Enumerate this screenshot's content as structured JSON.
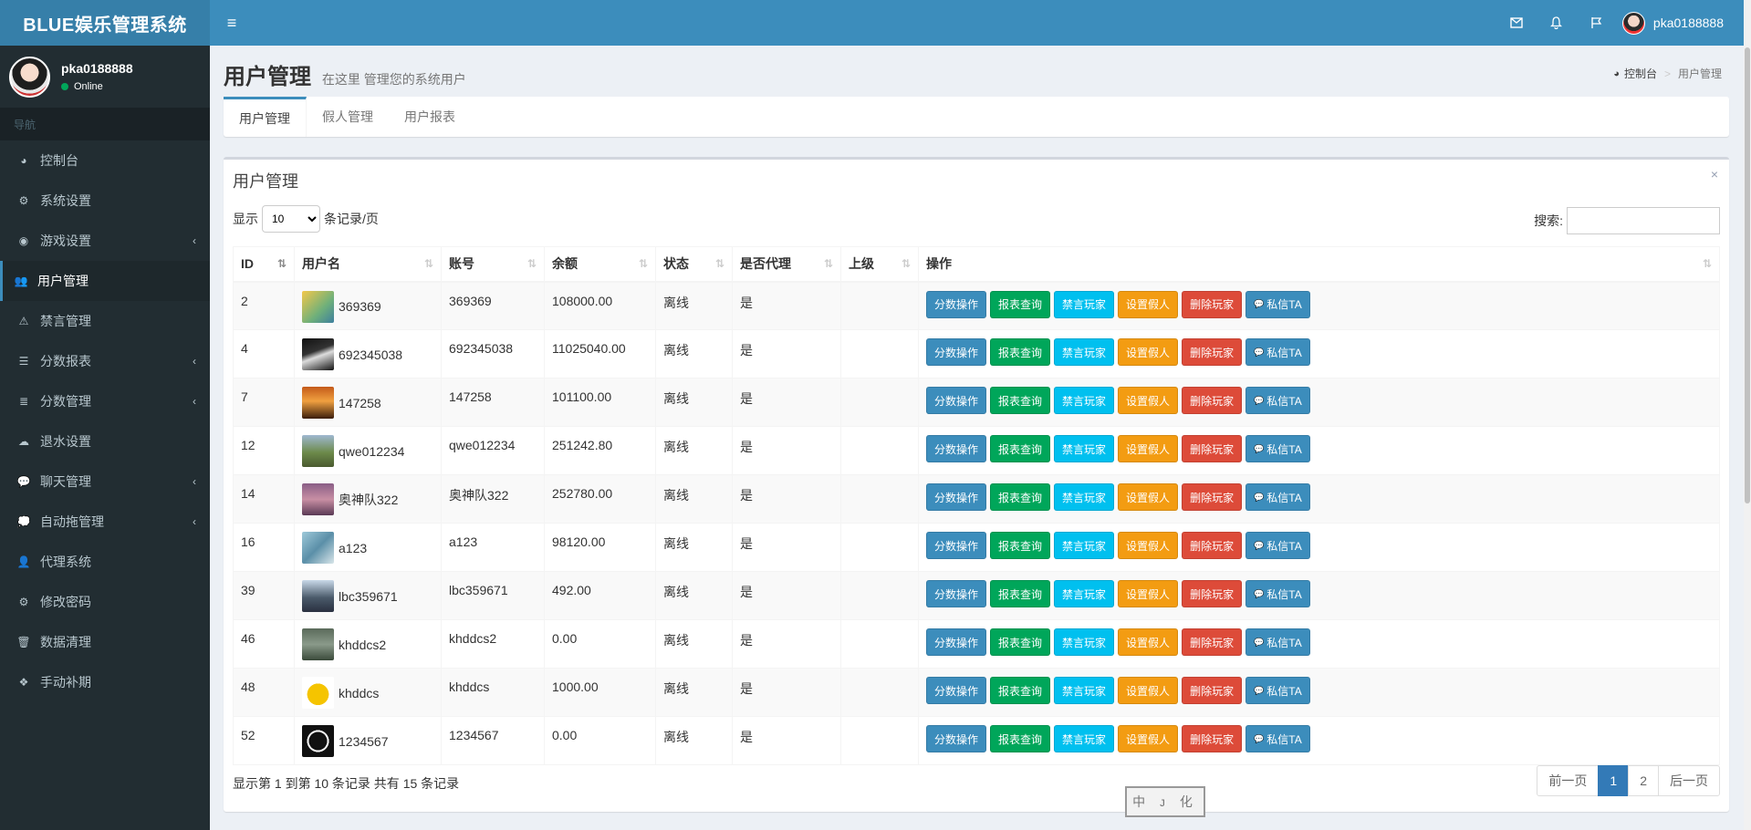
{
  "header": {
    "logo": "BLUE娱乐管理系统",
    "username": "pka0188888"
  },
  "sidebar": {
    "user": {
      "name": "pka0188888",
      "status": "Online"
    },
    "nav_header": "导航",
    "items": [
      {
        "label": "控制台",
        "icon": "dashboard-icon",
        "chev": ""
      },
      {
        "label": "系统设置",
        "icon": "cogs-icon",
        "chev": ""
      },
      {
        "label": "游戏设置",
        "icon": "gamepad-icon",
        "chev": "‹"
      },
      {
        "label": "用户管理",
        "icon": "users-icon",
        "chev": ""
      },
      {
        "label": "禁言管理",
        "icon": "warning-icon",
        "chev": ""
      },
      {
        "label": "分数报表",
        "icon": "list-icon",
        "chev": "‹"
      },
      {
        "label": "分数管理",
        "icon": "database-icon",
        "chev": "‹"
      },
      {
        "label": "退水设置",
        "icon": "cloud-upload-icon",
        "chev": ""
      },
      {
        "label": "聊天管理",
        "icon": "comments-icon",
        "chev": "‹"
      },
      {
        "label": "自动拖管理",
        "icon": "comment-icon",
        "chev": "‹"
      },
      {
        "label": "代理系统",
        "icon": "user-plus-icon",
        "chev": ""
      },
      {
        "label": "修改密码",
        "icon": "gear-icon",
        "chev": ""
      },
      {
        "label": "数据清理",
        "icon": "trash-icon",
        "chev": ""
      },
      {
        "label": "手动补期",
        "icon": "cubes-icon",
        "chev": ""
      }
    ],
    "active_index": 3
  },
  "content": {
    "title": "用户管理",
    "subtitle": "在这里 管理您的系统用户",
    "breadcrumb": {
      "home": "控制台",
      "current": "用户管理"
    },
    "tabs": [
      "用户管理",
      "假人管理",
      "用户报表"
    ],
    "box_title": "用户管理",
    "close_glyph": "×",
    "length": {
      "prefix": "显示",
      "value": "10",
      "suffix": "条记录/页"
    },
    "search_label": "搜索:",
    "columns": [
      "ID",
      "用户名",
      "账号",
      "余额",
      "状态",
      "是否代理",
      "上级",
      "操作"
    ],
    "buttons": [
      {
        "label": "分数操作",
        "color": "#3c8dbc"
      },
      {
        "label": "报表查询",
        "color": "#00a65a"
      },
      {
        "label": "禁言玩家",
        "color": "#00c0ef"
      },
      {
        "label": "设置假人",
        "color": "#f39c12"
      },
      {
        "label": "删除玩家",
        "color": "#dd4b39"
      },
      {
        "label": "私信TA",
        "color": "#3c8dbc"
      }
    ],
    "rows": [
      {
        "id": "2",
        "username": "369369",
        "account": "369369",
        "balance": "108000.00",
        "status": "离线",
        "agent": "是",
        "parent": ""
      },
      {
        "id": "4",
        "username": "692345038",
        "account": "692345038",
        "balance": "11025040.00",
        "status": "离线",
        "agent": "是",
        "parent": ""
      },
      {
        "id": "7",
        "username": "147258",
        "account": "147258",
        "balance": "101100.00",
        "status": "离线",
        "agent": "是",
        "parent": ""
      },
      {
        "id": "12",
        "username": "qwe012234",
        "account": "qwe012234",
        "balance": "251242.80",
        "status": "离线",
        "agent": "是",
        "parent": ""
      },
      {
        "id": "14",
        "username": "奥神队322",
        "account": "奥神队322",
        "balance": "252780.00",
        "status": "离线",
        "agent": "是",
        "parent": ""
      },
      {
        "id": "16",
        "username": "a123",
        "account": "a123",
        "balance": "98120.00",
        "status": "离线",
        "agent": "是",
        "parent": ""
      },
      {
        "id": "39",
        "username": "lbc359671",
        "account": "lbc359671",
        "balance": "492.00",
        "status": "离线",
        "agent": "是",
        "parent": ""
      },
      {
        "id": "46",
        "username": "khddcs2",
        "account": "khddcs2",
        "balance": "0.00",
        "status": "离线",
        "agent": "是",
        "parent": ""
      },
      {
        "id": "48",
        "username": "khddcs",
        "account": "khddcs",
        "balance": "1000.00",
        "status": "离线",
        "agent": "是",
        "parent": ""
      },
      {
        "id": "52",
        "username": "1234567",
        "account": "1234567",
        "balance": "0.00",
        "status": "离线",
        "agent": "是",
        "parent": ""
      }
    ],
    "info": "显示第 1 到第 10 条记录 共有 15 条记录",
    "pager": {
      "prev": "前一页",
      "pages": [
        "1",
        "2"
      ],
      "next": "后一页",
      "active": "1"
    },
    "stamp": "中 ᴊ 化"
  }
}
